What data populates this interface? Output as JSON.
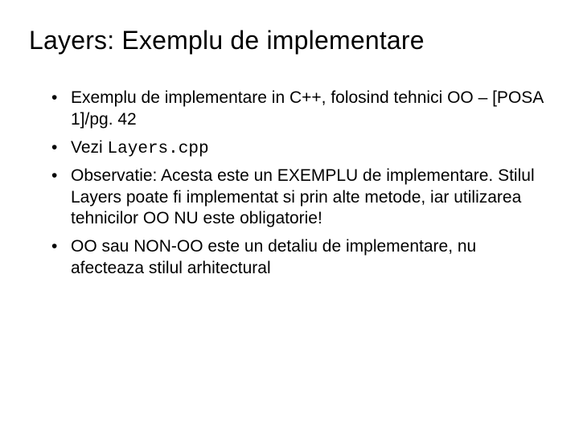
{
  "title": "Layers:  Exemplu de implementare",
  "bullets": [
    {
      "pre": "Exemplu de implementare in C++, folosind tehnici OO – [POSA 1]/pg. 42",
      "code": "",
      "post": ""
    },
    {
      "pre": "Vezi ",
      "code": "Layers.cpp",
      "post": ""
    },
    {
      "pre": "Observatie: Acesta este un EXEMPLU de implementare. Stilul Layers poate fi implementat si prin alte metode, iar utilizarea tehnicilor OO NU este obligatorie!",
      "code": "",
      "post": ""
    },
    {
      "pre": "OO sau NON-OO este un detaliu de implementare, nu afecteaza stilul arhitectural",
      "code": "",
      "post": ""
    }
  ]
}
